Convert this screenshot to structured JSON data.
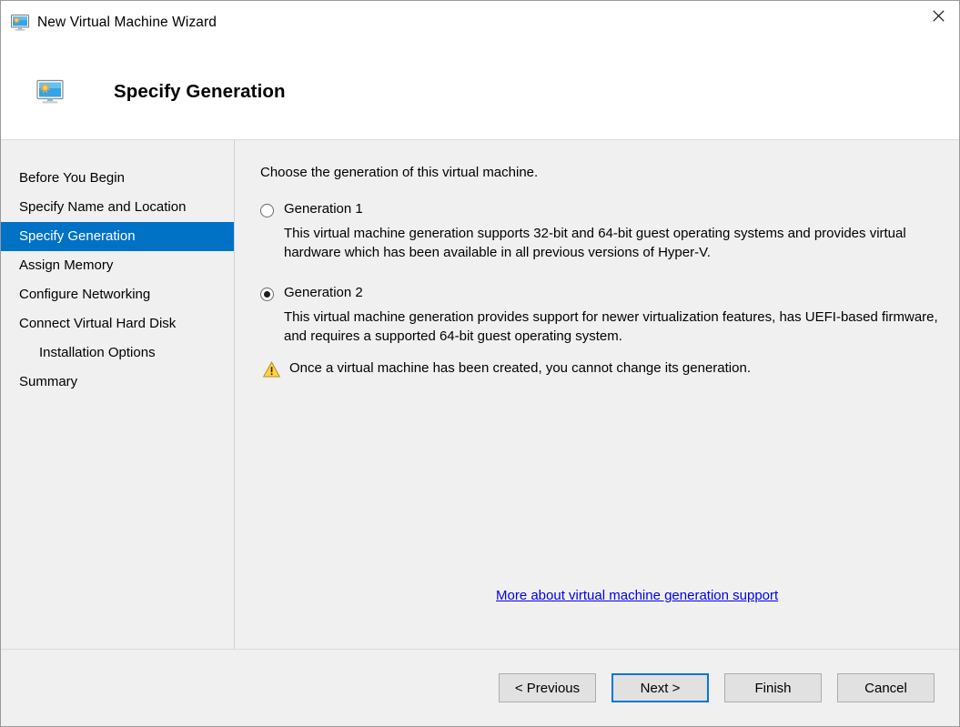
{
  "window": {
    "title": "New Virtual Machine Wizard",
    "title_icon": "virtual-machine-monitor-icon",
    "close_label": "✕"
  },
  "banner": {
    "icon": "virtual-machine-monitor-icon",
    "title": "Specify Generation"
  },
  "sidebar": {
    "items": [
      {
        "label": "Before You Begin",
        "selected": false,
        "indent": false
      },
      {
        "label": "Specify Name and Location",
        "selected": false,
        "indent": false
      },
      {
        "label": "Specify Generation",
        "selected": true,
        "indent": false
      },
      {
        "label": "Assign Memory",
        "selected": false,
        "indent": false
      },
      {
        "label": "Configure Networking",
        "selected": false,
        "indent": false
      },
      {
        "label": "Connect Virtual Hard Disk",
        "selected": false,
        "indent": false
      },
      {
        "label": "Installation Options",
        "selected": false,
        "indent": true
      },
      {
        "label": "Summary",
        "selected": false,
        "indent": false
      }
    ]
  },
  "main": {
    "intro": "Choose the generation of this virtual machine.",
    "options": [
      {
        "label": "Generation 1",
        "checked": false,
        "description": "This virtual machine generation supports 32-bit and 64-bit guest operating systems and provides virtual hardware which has been available in all previous versions of Hyper-V."
      },
      {
        "label": "Generation 2",
        "checked": true,
        "description": "This virtual machine generation provides support for newer virtualization features, has UEFI-based firmware, and requires a supported 64-bit guest operating system."
      }
    ],
    "warning": {
      "icon": "warning-triangle-icon",
      "text": "Once a virtual machine has been created, you cannot change its generation."
    },
    "help_link": "More about virtual machine generation support"
  },
  "footer": {
    "buttons": [
      {
        "label": "< Previous",
        "default": false
      },
      {
        "label": "Next >",
        "default": true
      },
      {
        "label": "Finish",
        "default": false
      },
      {
        "label": "Cancel",
        "default": false
      }
    ]
  },
  "colors": {
    "accent": "#0072c6",
    "focus": "#0078d7",
    "link": "#0000ee",
    "warning": "#f0a30a",
    "window_bg": "#f0f0f0",
    "header_bg": "#ffffff"
  }
}
